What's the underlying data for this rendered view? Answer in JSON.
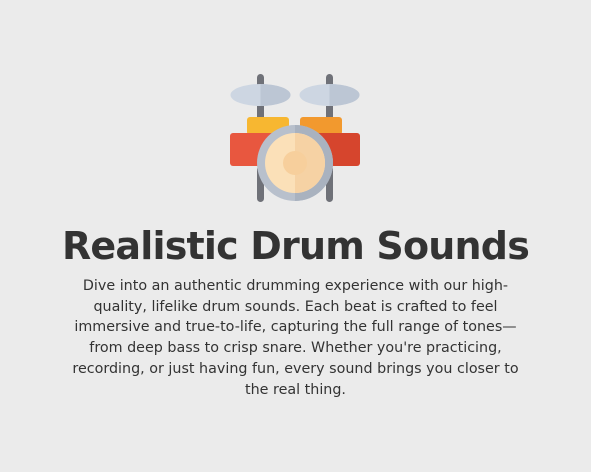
{
  "feature": {
    "icon": "drum-kit-icon",
    "title": "Realistic Drum Sounds",
    "description": "Dive into an authentic drumming experience with our high-quality, lifelike drum sounds. Each beat is crafted to feel immersive and true-to-life, capturing the full range of tones—from deep bass to crisp snare. Whether you're practicing, recording, or just having fun, every sound brings you closer to the real thing."
  },
  "colors": {
    "background": "#ebebeb",
    "text": "#333333",
    "cymbal": "#cdd6e2",
    "stand": "#6f7178",
    "tom_left": "#f7b731",
    "tom_right": "#f2992e",
    "drum_shell_left": "#e8573f",
    "drum_shell_right": "#d6452d",
    "bass_rim": "#b8c0cc",
    "bass_head": "#fbe0b8"
  }
}
